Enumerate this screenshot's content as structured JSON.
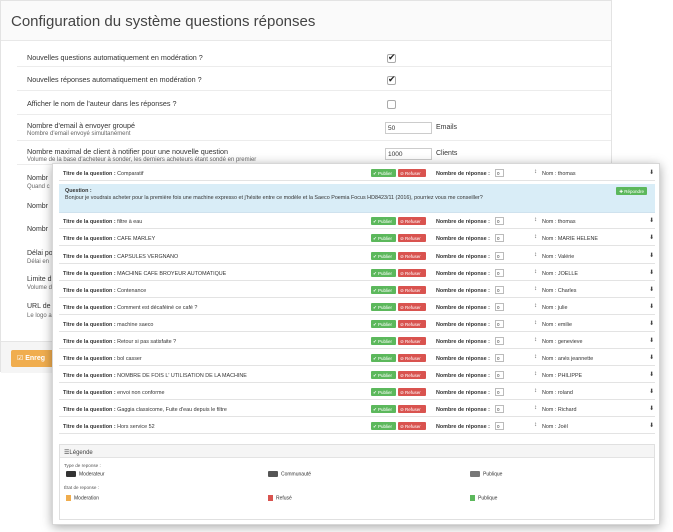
{
  "config": {
    "title": "Configuration du système questions réponses",
    "rows": [
      {
        "label": "Nouvelles questions automatiquement en modération ?",
        "sub": "",
        "checked": true
      },
      {
        "label": "Nouvelles réponses automatiquement en modération ?",
        "sub": "",
        "checked": true
      },
      {
        "label": "Afficher le nom de l'auteur dans les réponses ?",
        "sub": "",
        "checked": false
      },
      {
        "label": "Nombre d'email à envoyer groupé",
        "sub": "Nombre d'email envoyé simultanément",
        "value": "50",
        "unit": "Emails"
      },
      {
        "label": "Nombre maximal de client à notifier pour une nouvelle question",
        "sub": "Volume de la base d'acheteur à sonder, les derniers acheteurs étant sondé en premier",
        "value": "1000",
        "unit": "Clients"
      }
    ],
    "partial_rows": [
      "Nombr",
      "Quand c",
      "Nombr",
      "Nombr",
      "Délai po",
      "Délai en",
      "Limite d",
      "Volume d",
      "URL de",
      "Le logo a"
    ],
    "save_label": "Enreg"
  },
  "questions": {
    "title_label": "Titre de la question :",
    "count_label": "Nombre de réponse :",
    "publish_label": "Publier",
    "refuse_label": "Refuser",
    "reply_label": "Répondre",
    "detail_heading": "Question :",
    "detail_text": "Bonjour je voudrais acheter pour la première fois une machine expresso et j'hésite entre ce modèle et la Saeco Poemia Focus HD8423/11 (2016), pourriez vous me conseiller?",
    "rows": [
      {
        "title": "Comparatif",
        "count": "0",
        "name": "Nom : thomas"
      },
      {
        "title": "filtre à eau",
        "count": "0",
        "name": "Nom : thomas"
      },
      {
        "title": "CAFE MARLEY",
        "count": "0",
        "name": "Nom : MARIE HELENE"
      },
      {
        "title": "CAPSULES VERGNANO",
        "count": "0",
        "name": "Nom : Valérie"
      },
      {
        "title": "MACHINE CAFE BROYEUR AUTOMATIQUE",
        "count": "0",
        "name": "Nom : JOELLE"
      },
      {
        "title": "Contenance",
        "count": "0",
        "name": "Nom : Charles"
      },
      {
        "title": "Comment est décaféiné ce café ?",
        "count": "0",
        "name": "Nom : julie"
      },
      {
        "title": "machine saeco",
        "count": "0",
        "name": "Nom : emilie"
      },
      {
        "title": "Retour si pas satisfaite ?",
        "count": "0",
        "name": "Nom : genevieve"
      },
      {
        "title": "bol casser",
        "count": "0",
        "name": "Nom : anés jeannette"
      },
      {
        "title": "NOMBRE DE FOIS L' UTILISATION DE LA MACHINE",
        "count": "0",
        "name": "Nom : PHILIPPE"
      },
      {
        "title": "envoi non conforme",
        "count": "0",
        "name": "Nom : roland"
      },
      {
        "title": "Gaggia classicome, Fuite d'eau depuis le filtre",
        "count": "0",
        "name": "Nom : Richard"
      },
      {
        "title": "Hors service 52",
        "count": "0",
        "name": "Nom : Joël"
      }
    ]
  },
  "legend": {
    "title": "Légende",
    "type_label": "Type de reponse :",
    "types": [
      "Moderateur",
      "Communauté",
      "Publique"
    ],
    "state_label": "État de reponse :",
    "states": [
      "Moderation",
      "Refusé",
      "Publique"
    ],
    "state_colors": [
      "#f0ad4e",
      "#d9534f",
      "#5cb85c"
    ]
  }
}
